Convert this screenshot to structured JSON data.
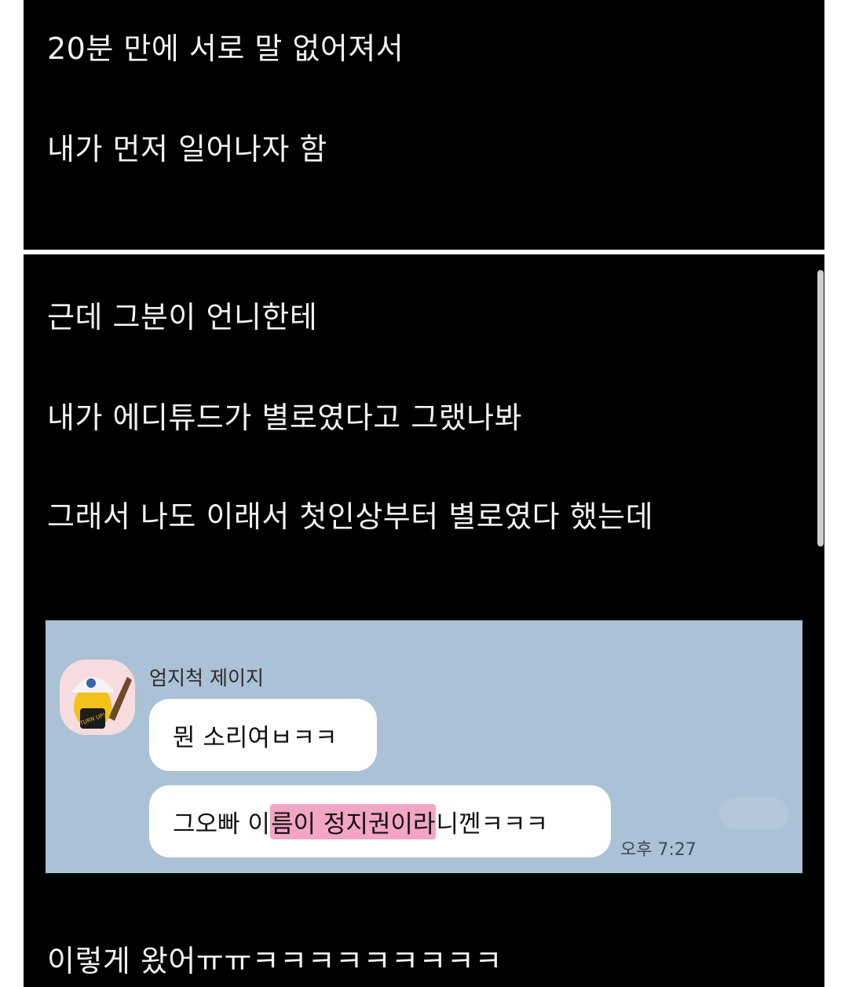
{
  "top_panel": {
    "lines": [
      "20분 만에 서로 말 없어져서",
      "내가 먼저 일어나자 함"
    ]
  },
  "main_panel": {
    "lines": [
      "근데 그분이 언니한테",
      "내가 에디튜드가 별로였다고 그랬나봐",
      "그래서 나도 이래서 첫인상부터 별로였다 했는데"
    ],
    "footer_line": "이렇게 왔어ㅠㅠㅋㅋㅋㅋㅋㅋㅋㅋㅋ"
  },
  "chat": {
    "sender_name": "엄지척 제이지",
    "avatar_text": "TURN UP!",
    "message1": "뭔 소리여ㅂㅋㅋ",
    "message2": {
      "before": "그오빠 이",
      "highlight": "름이 정지권이라",
      "after": "니껜ㅋㅋㅋ"
    },
    "timestamp": "오후 7:27",
    "background_color": "#abc1d5",
    "highlight_color": "#ec6ea0"
  }
}
